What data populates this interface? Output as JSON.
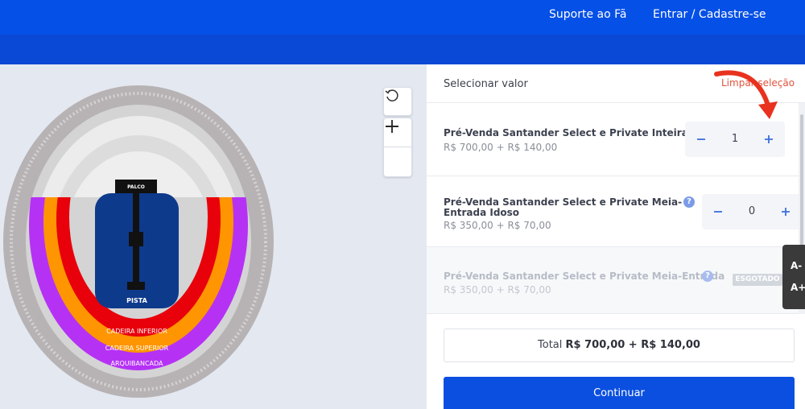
{
  "header": {
    "support_label": "Suporte ao Fã",
    "login_label": "Entrar / Cadastre-se"
  },
  "map": {
    "stage_label": "PALCO",
    "pista_label": "PISTA",
    "sector_inferior": "CADEIRA INFERIOR",
    "sector_superior": "CADEIRA SUPERIOR",
    "sector_arquibancada": "ARQUIBANCADA",
    "controls": {
      "reset_icon": "rotate-ccw-icon",
      "zoom_in_icon": "plus-icon",
      "zoom_out_icon": "minus-icon"
    },
    "colors": {
      "inferior": "#e8000b",
      "superior": "#ff9500",
      "arquibancada": "#b532f5",
      "pista": "#0e3a8c",
      "outer_ring": "#b7b3b4"
    }
  },
  "panel": {
    "title": "Selecionar valor",
    "clear_label": "Limpar seleção",
    "tickets": [
      {
        "name": "Pré-Venda Santander Select e Private Inteira",
        "price": "R$ 700,00 + R$ 140,00",
        "quantity": "1",
        "sold_out": false
      },
      {
        "name_line1": "Pré-Venda Santander Select e Private Meia-",
        "name_line2": "Entrada Idoso",
        "price": "R$ 350,00 + R$ 70,00",
        "quantity": "0",
        "help": "?",
        "sold_out": false
      },
      {
        "name": "Pré-Venda Santander Select e Private Meia-Entrada",
        "price": "R$ 350,00 + R$ 70,00",
        "help": "?",
        "badge": "ESGOTADO",
        "sold_out": true
      }
    ],
    "total_prefix": "Total",
    "total_value": "R$ 700,00 + R$ 140,00",
    "continue_label": "Continuar"
  },
  "accessibility": {
    "decrease_label": "A-",
    "increase_label": "A+"
  },
  "colors": {
    "brand_blue": "#0550e6",
    "accent_red": "#e0533b"
  }
}
